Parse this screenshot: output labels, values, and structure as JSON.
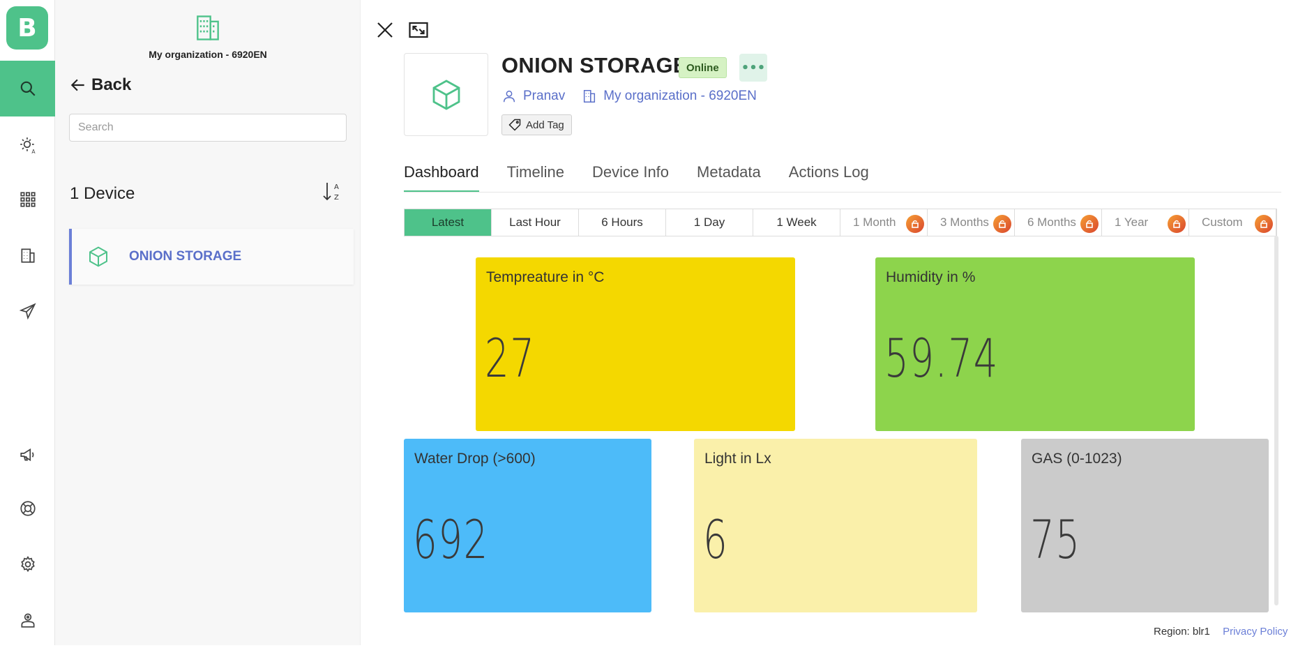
{
  "app": {
    "logo_letter": "B",
    "accent": "#4ec28a",
    "link_color": "#5a6fc9"
  },
  "rail": {
    "items": [
      {
        "name": "search-icon",
        "active": true
      },
      {
        "name": "sun-a-icon",
        "active": false
      },
      {
        "name": "apps-grid-icon",
        "active": false
      },
      {
        "name": "building-icon",
        "active": false
      },
      {
        "name": "send-icon",
        "active": false
      },
      {
        "name": "megaphone-icon",
        "active": false
      },
      {
        "name": "lifebuoy-icon",
        "active": false
      },
      {
        "name": "settings-icon",
        "active": false
      },
      {
        "name": "user-badge-icon",
        "active": false
      }
    ]
  },
  "panel": {
    "org_name": "My organization - 6920EN",
    "back_label": "Back",
    "search_placeholder": "Search",
    "device_count": "1 Device",
    "devices": [
      {
        "name": "ONION STORAGE"
      }
    ]
  },
  "device": {
    "title": "ONION STORAGE",
    "status": "Online",
    "owner": "Pranav",
    "organization": "My organization - 6920EN",
    "add_tag_label": "Add Tag"
  },
  "tabs": [
    {
      "label": "Dashboard",
      "active": true
    },
    {
      "label": "Timeline",
      "active": false
    },
    {
      "label": "Device Info",
      "active": false
    },
    {
      "label": "Metadata",
      "active": false
    },
    {
      "label": "Actions Log",
      "active": false
    }
  ],
  "ranges": [
    {
      "label": "Latest",
      "active": true,
      "locked": false
    },
    {
      "label": "Last Hour",
      "active": false,
      "locked": false
    },
    {
      "label": "6 Hours",
      "active": false,
      "locked": false
    },
    {
      "label": "1 Day",
      "active": false,
      "locked": false
    },
    {
      "label": "1 Week",
      "active": false,
      "locked": false
    },
    {
      "label": "1 Month",
      "active": false,
      "locked": true
    },
    {
      "label": "3 Months",
      "active": false,
      "locked": true
    },
    {
      "label": "6 Months",
      "active": false,
      "locked": true
    },
    {
      "label": "1 Year",
      "active": false,
      "locked": true
    },
    {
      "label": "Custom",
      "active": false,
      "locked": true
    }
  ],
  "tiles": [
    {
      "label": "Tempreature in °C",
      "value": "27",
      "color": "#f4d800"
    },
    {
      "label": "Humidity in %",
      "value": "59.74",
      "color": "#8dd44c"
    },
    {
      "label": "Water Drop (>600)",
      "value": "692",
      "color": "#4dbbf9"
    },
    {
      "label": "Light in Lx",
      "value": "6",
      "color": "#faf0aa"
    },
    {
      "label": "GAS (0-1023)",
      "value": "75",
      "color": "#cbcbcb"
    }
  ],
  "footer": {
    "region": "Region: blr1",
    "privacy": "Privacy Policy"
  }
}
